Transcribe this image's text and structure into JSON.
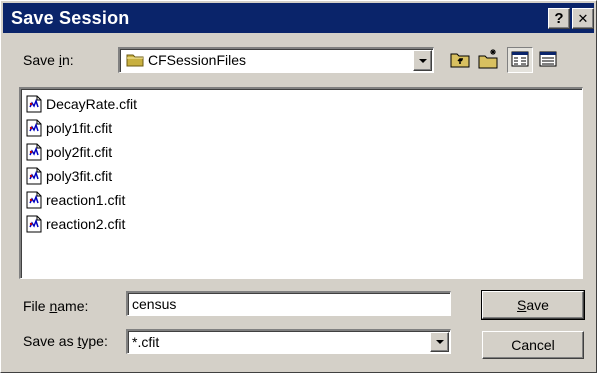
{
  "window": {
    "title": "Save Session",
    "help_label": "?",
    "close_label": "✕"
  },
  "save_in": {
    "label_pre": "Save ",
    "label_key": "i",
    "label_post": "n:",
    "value": "CFSessionFiles"
  },
  "toolbar": {
    "icons": [
      "up-one-level-icon",
      "create-new-folder-icon",
      "list-view-icon",
      "details-view-icon"
    ]
  },
  "files": [
    {
      "name": "DecayRate.cfit"
    },
    {
      "name": "poly1fit.cfit"
    },
    {
      "name": "poly2fit.cfit"
    },
    {
      "name": "poly3fit.cfit"
    },
    {
      "name": "reaction1.cfit"
    },
    {
      "name": "reaction2.cfit"
    }
  ],
  "file_name": {
    "label_pre": "File ",
    "label_key": "n",
    "label_post": "ame:",
    "value": "census"
  },
  "save_as_type": {
    "label_pre": "Save as ",
    "label_key": "t",
    "label_post": "ype:",
    "value": "*.cfit"
  },
  "buttons": {
    "save_key": "S",
    "save_rest": "ave",
    "cancel": "Cancel"
  },
  "colors": {
    "titlebar": "#0a246a",
    "face": "#d4d0c8"
  }
}
